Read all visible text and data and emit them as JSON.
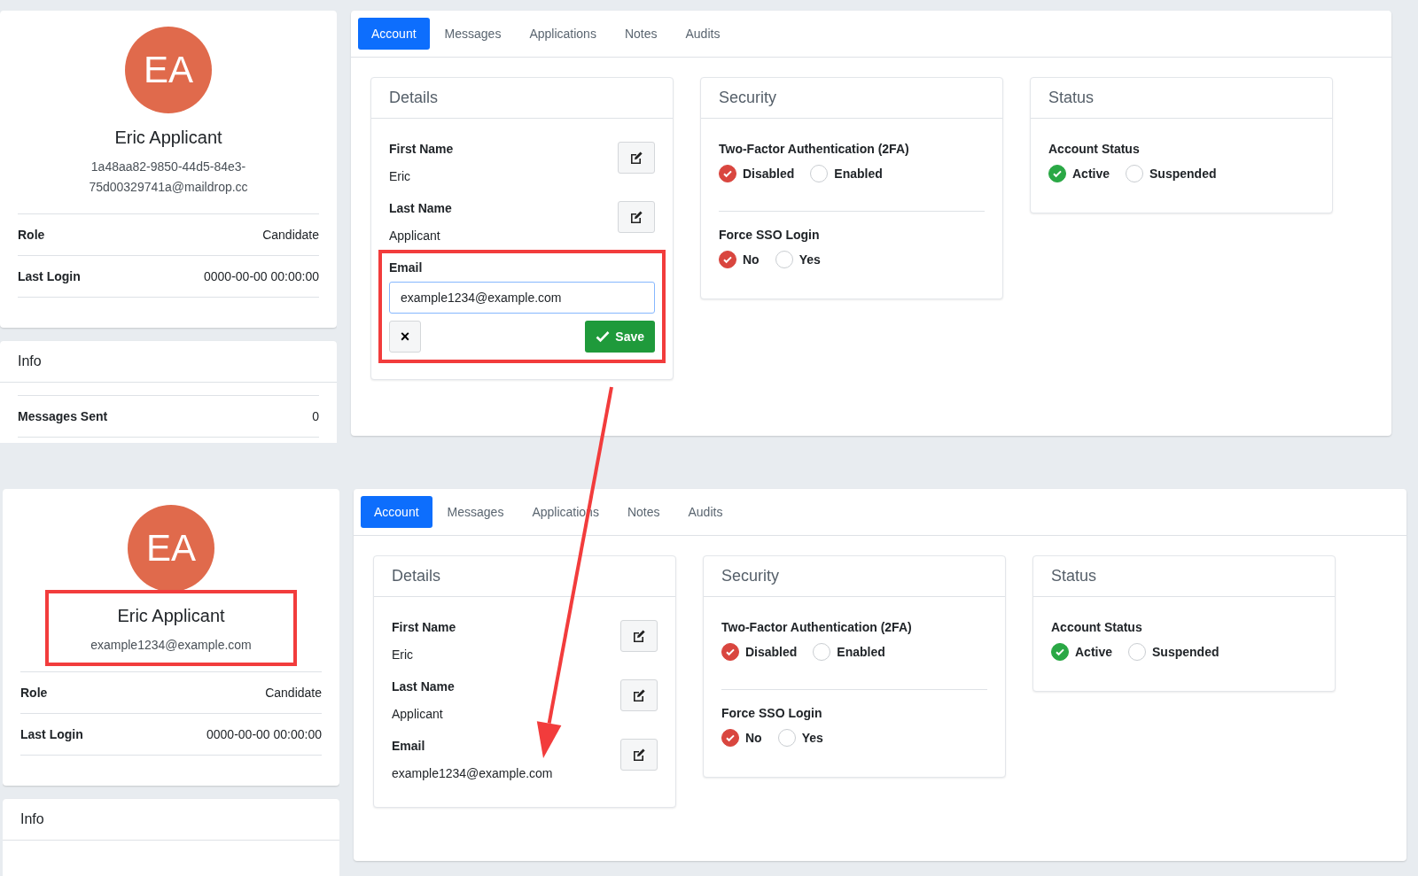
{
  "panels": [
    {
      "profile": {
        "initials": "EA",
        "name": "Eric Applicant",
        "email": "1a48aa82-9850-44d5-84e3-75d00329741a@maildrop.cc",
        "highlighted": false
      },
      "profile_rows": [
        {
          "label": "Role",
          "value": "Candidate"
        },
        {
          "label": "Last Login",
          "value": "0000-00-00 00:00:00"
        }
      ],
      "info": {
        "title": "Info",
        "rows": [
          {
            "label": "Messages Sent",
            "value": "0"
          }
        ]
      },
      "tabs": [
        {
          "label": "Account",
          "selected": true
        },
        {
          "label": "Messages",
          "selected": false
        },
        {
          "label": "Applications",
          "selected": false
        },
        {
          "label": "Notes",
          "selected": false
        },
        {
          "label": "Audits",
          "selected": false
        }
      ],
      "details": {
        "title": "Details",
        "fields": [
          {
            "kind": "display",
            "label": "First Name",
            "value": "Eric"
          },
          {
            "kind": "display",
            "label": "Last Name",
            "value": "Applicant"
          },
          {
            "kind": "editing",
            "label": "Email",
            "value": "example1234@example.com",
            "highlighted": true,
            "cancel": "×",
            "save": "Save"
          }
        ]
      },
      "security": {
        "title": "Security",
        "groups": [
          {
            "label": "Two-Factor Authentication (2FA)",
            "kind": "danger",
            "options": [
              {
                "label": "Disabled",
                "selected": true
              },
              {
                "label": "Enabled",
                "selected": false
              }
            ]
          },
          {
            "label": "Force SSO Login",
            "kind": "danger",
            "options": [
              {
                "label": "No",
                "selected": true
              },
              {
                "label": "Yes",
                "selected": false
              }
            ]
          }
        ]
      },
      "status": {
        "title": "Status",
        "groups": [
          {
            "label": "Account Status",
            "kind": "success",
            "options": [
              {
                "label": "Active",
                "selected": true
              },
              {
                "label": "Suspended",
                "selected": false
              }
            ]
          }
        ]
      }
    },
    {
      "profile": {
        "initials": "EA",
        "name": "Eric Applicant",
        "email": "example1234@example.com",
        "highlighted": true
      },
      "profile_rows": [
        {
          "label": "Role",
          "value": "Candidate"
        },
        {
          "label": "Last Login",
          "value": "0000-00-00 00:00:00"
        }
      ],
      "info": {
        "title": "Info"
      },
      "tabs": [
        {
          "label": "Account",
          "selected": true
        },
        {
          "label": "Messages",
          "selected": false
        },
        {
          "label": "Applications",
          "selected": false
        },
        {
          "label": "Notes",
          "selected": false
        },
        {
          "label": "Audits",
          "selected": false
        }
      ],
      "details": {
        "title": "Details",
        "fields": [
          {
            "kind": "display",
            "label": "First Name",
            "value": "Eric"
          },
          {
            "kind": "display",
            "label": "Last Name",
            "value": "Applicant"
          },
          {
            "kind": "display",
            "label": "Email",
            "value": "example1234@example.com"
          }
        ]
      },
      "security": {
        "title": "Security",
        "groups": [
          {
            "label": "Two-Factor Authentication (2FA)",
            "kind": "danger",
            "options": [
              {
                "label": "Disabled",
                "selected": true
              },
              {
                "label": "Enabled",
                "selected": false
              }
            ]
          },
          {
            "label": "Force SSO Login",
            "kind": "danger",
            "options": [
              {
                "label": "No",
                "selected": true
              },
              {
                "label": "Yes",
                "selected": false
              }
            ]
          }
        ]
      },
      "status": {
        "title": "Status",
        "groups": [
          {
            "label": "Account Status",
            "kind": "success",
            "options": [
              {
                "label": "Active",
                "selected": true
              },
              {
                "label": "Suspended",
                "selected": false
              }
            ]
          }
        ]
      }
    }
  ]
}
